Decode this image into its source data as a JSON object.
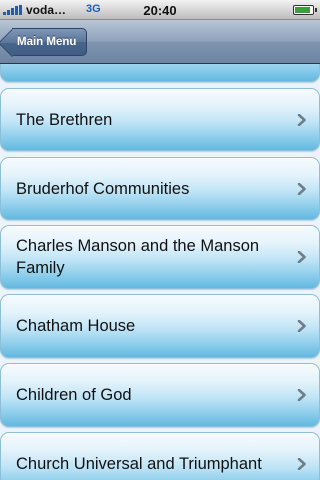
{
  "status_bar": {
    "carrier": "voda…",
    "network": "3G",
    "time": "20:40",
    "battery_level": 0.9
  },
  "nav": {
    "back_label": "Main Menu"
  },
  "list": {
    "items": [
      {
        "label": ""
      },
      {
        "label": "The Brethren"
      },
      {
        "label": "Bruderhof Communities"
      },
      {
        "label": "Charles Manson and the Manson Family"
      },
      {
        "label": "Chatham House"
      },
      {
        "label": "Children of God"
      },
      {
        "label": "Church Universal and Triumphant"
      }
    ]
  },
  "colors": {
    "row_gradient_top": "#f6fbfe",
    "row_gradient_bottom": "#63b8e0",
    "nav_bar": "#8ea2ba",
    "back_button": "#48658c",
    "chevron": "#6f7f8a"
  }
}
